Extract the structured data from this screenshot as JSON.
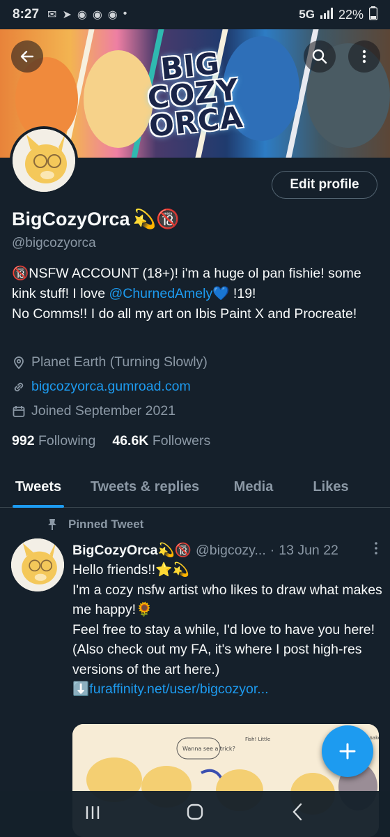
{
  "status_bar": {
    "time": "8:27",
    "network": "5G",
    "battery": "22%",
    "notification_icons": [
      "mail-icon",
      "telegram-icon",
      "discord-icon",
      "discord-icon",
      "discord-icon",
      "dot-icon"
    ]
  },
  "banner": {
    "logo_lines": [
      "BIG",
      "COZY",
      "ORCA"
    ]
  },
  "profile": {
    "edit_button": "Edit profile",
    "display_name": "BigCozyOrca",
    "name_emoji": "💫🔞",
    "handle": "@bigcozyorca",
    "bio": {
      "part1": "🔞NSFW ACCOUNT (18+)!  i'm a huge ol pan fishie! some kink stuff!  I love ",
      "mention": "@ChurnedAmely",
      "part2": "💙  !19!",
      "part3": "No Comms!!   I do all my art on Ibis Paint X and Procreate!"
    },
    "location": "Planet Earth (Turning Slowly)",
    "website": "bigcozyorca.gumroad.com",
    "joined": "Joined September 2021",
    "following_count": "992",
    "following_label": "Following",
    "followers_count": "46.6K",
    "followers_label": "Followers"
  },
  "tabs": [
    {
      "label": "Tweets",
      "active": true
    },
    {
      "label": "Tweets & replies",
      "active": false
    },
    {
      "label": "Media",
      "active": false
    },
    {
      "label": "Likes",
      "active": false
    }
  ],
  "tweet": {
    "pinned_label": "Pinned Tweet",
    "author_name": "BigCozyOrca",
    "author_emoji": "💫🔞",
    "author_handle": "@bigcozy...",
    "separator": "·",
    "date": "13 Jun 22",
    "line1": "Hello friends!!⭐💫",
    "line2": "I'm a cozy nsfw artist who likes to draw what makes me happy!🌻",
    "line3": "Feel free to stay a while, I'd love to have you here!",
    "line4": "(Also check out my FA, it's where I post high-res versions of the art here.)",
    "link_prefix": "⬇️",
    "link": "furaffinity.net/user/bigcozyor...",
    "media_texts": [
      "Wanna see a trick?",
      "Fish! Little ",
      "Why are you naked?"
    ]
  },
  "colors": {
    "background": "#15202b",
    "accent": "#1d9bf0",
    "secondary_text": "#8b98a5",
    "border": "#38444d"
  }
}
